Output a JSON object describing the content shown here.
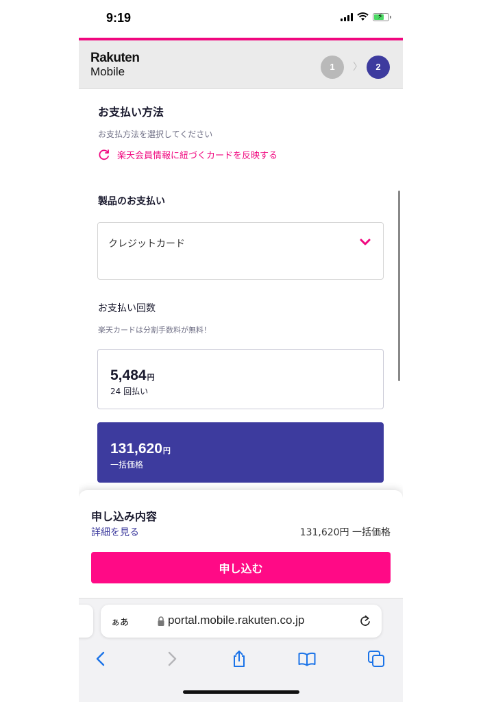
{
  "status_bar": {
    "time": "9:19"
  },
  "header": {
    "logo_line1": "Rakuten",
    "logo_line2": "Mobile",
    "step1": "1",
    "step2": "2"
  },
  "payment": {
    "title": "お支払い方法",
    "subtitle": "お支払方法を選択してください",
    "reflect_link": "楽天会員情報に紐づくカードを反映する",
    "product_section": "製品のお支払い",
    "method_value": "クレジットカード",
    "count_label": "お支払い回数",
    "count_note": "楽天カードは分割手数料が無料！",
    "options": [
      {
        "amount": "5,484",
        "unit": "円",
        "desc": "24 回払い",
        "selected": false
      },
      {
        "amount": "131,620",
        "unit": "円",
        "desc": "一括価格",
        "selected": true
      }
    ]
  },
  "summary": {
    "title": "申し込み内容",
    "detail_link": "詳細を見る",
    "total": "131,620円 一括価格",
    "submit": "申し込む"
  },
  "browser": {
    "aa": "ぁあ",
    "url": "portal.mobile.rakuten.co.jp"
  },
  "colors": {
    "brand_pink": "#f0077f",
    "button_pink": "#ff0a86",
    "selected_purple": "#3d3b9e"
  },
  "icons": [
    "signal-icon",
    "wifi-icon",
    "battery-icon",
    "refresh-icon",
    "chevron-down-icon",
    "lock-icon",
    "reload-icon",
    "back-icon",
    "forward-icon",
    "share-icon",
    "bookmarks-icon",
    "tabs-icon"
  ]
}
